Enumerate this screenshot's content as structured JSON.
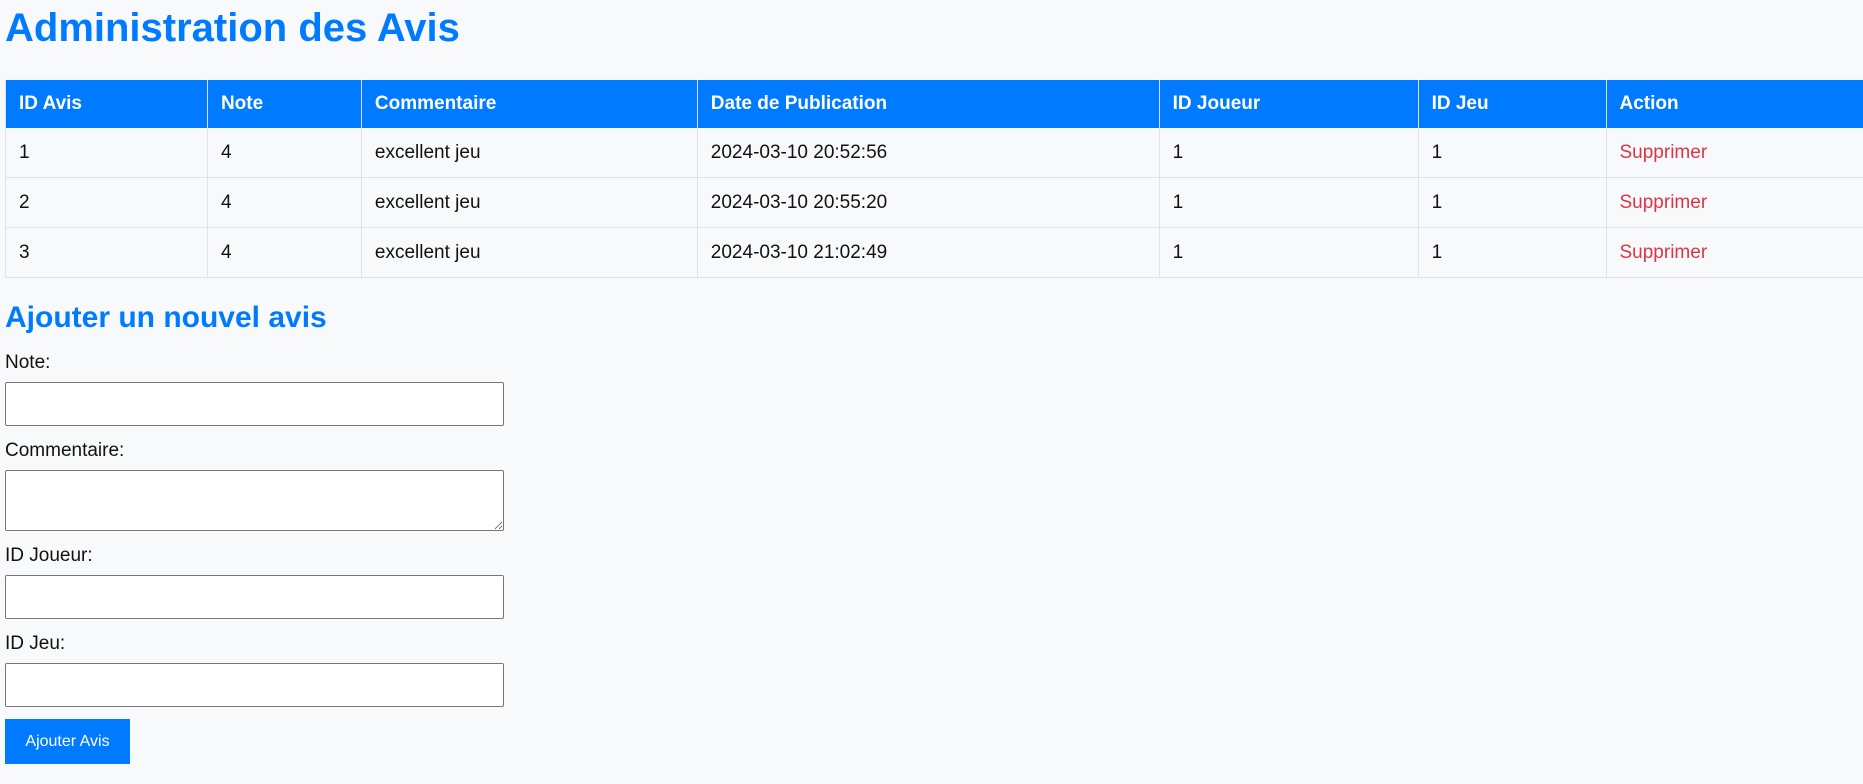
{
  "page": {
    "title": "Administration des Avis"
  },
  "reviews_table": {
    "headers": [
      "ID Avis",
      "Note",
      "Commentaire",
      "Date de Publication",
      "ID Joueur",
      "ID Jeu",
      "Action"
    ],
    "rows": [
      {
        "id": "1",
        "note": "4",
        "comment": "excellent jeu",
        "date": "2024-03-10 20:52:56",
        "player_id": "1",
        "game_id": "1",
        "action": "Supprimer"
      },
      {
        "id": "2",
        "note": "4",
        "comment": "excellent jeu",
        "date": "2024-03-10 20:55:20",
        "player_id": "1",
        "game_id": "1",
        "action": "Supprimer"
      },
      {
        "id": "3",
        "note": "4",
        "comment": "excellent jeu",
        "date": "2024-03-10 21:02:49",
        "player_id": "1",
        "game_id": "1",
        "action": "Supprimer"
      }
    ]
  },
  "add_form": {
    "title": "Ajouter un nouvel avis",
    "note_label": "Note:",
    "note_value": "",
    "comment_label": "Commentaire:",
    "comment_value": "",
    "player_id_label": "ID Joueur:",
    "player_id_value": "",
    "game_id_label": "ID Jeu:",
    "game_id_value": "",
    "submit_label": "Ajouter Avis"
  },
  "colors": {
    "accent": "#007bff",
    "danger": "#dc3545",
    "background": "#f8f9fa"
  }
}
